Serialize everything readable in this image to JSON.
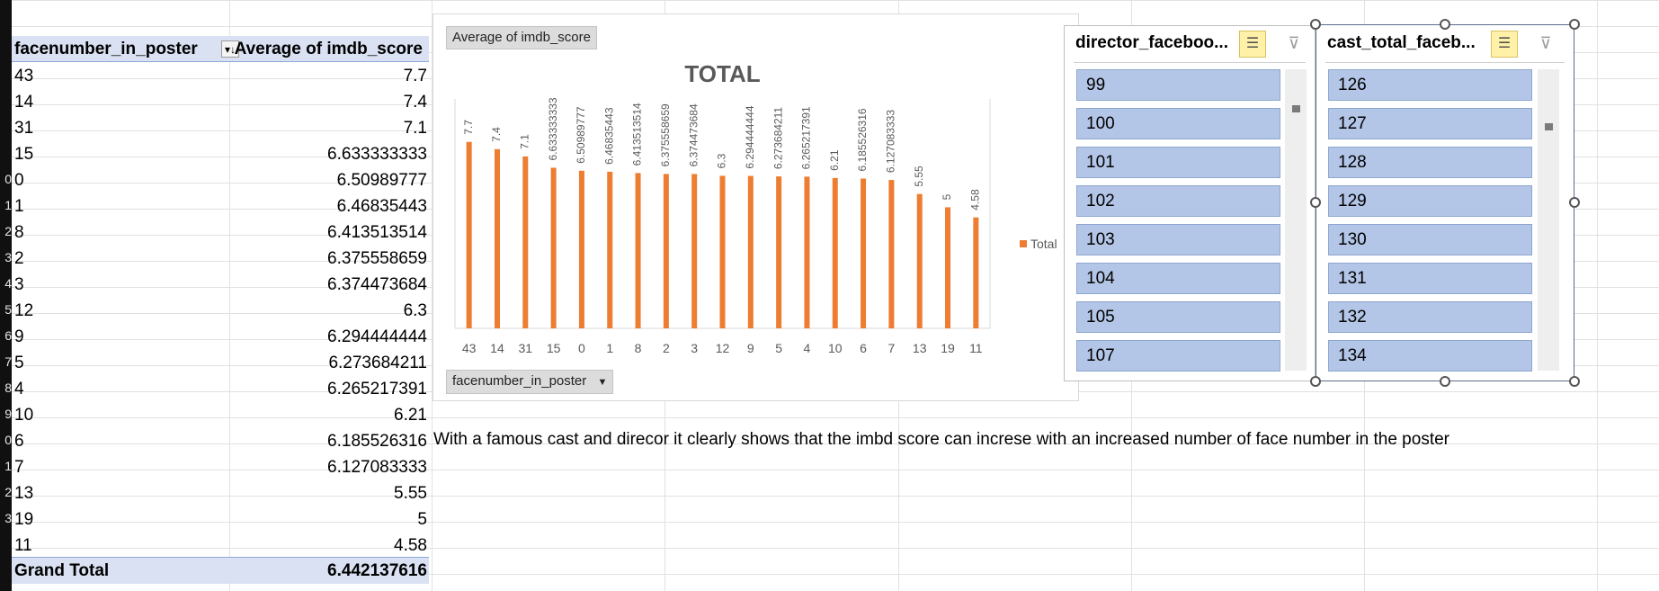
{
  "pivot": {
    "col1_header": "facenumber_in_poster",
    "col2_header": "Average of imdb_score",
    "sort_icon": "sort-descending-icon",
    "rows": [
      {
        "k": "43",
        "v": "7.7"
      },
      {
        "k": "14",
        "v": "7.4"
      },
      {
        "k": "31",
        "v": "7.1"
      },
      {
        "k": "15",
        "v": "6.633333333"
      },
      {
        "k": "0",
        "v": "6.50989777"
      },
      {
        "k": "1",
        "v": "6.46835443"
      },
      {
        "k": "8",
        "v": "6.413513514"
      },
      {
        "k": "2",
        "v": "6.375558659"
      },
      {
        "k": "3",
        "v": "6.374473684"
      },
      {
        "k": "12",
        "v": "6.3"
      },
      {
        "k": "9",
        "v": "6.294444444"
      },
      {
        "k": "5",
        "v": "6.273684211"
      },
      {
        "k": "4",
        "v": "6.265217391"
      },
      {
        "k": "10",
        "v": "6.21"
      },
      {
        "k": "6",
        "v": "6.185526316"
      },
      {
        "k": "7",
        "v": "6.127083333"
      },
      {
        "k": "13",
        "v": "5.55"
      },
      {
        "k": "19",
        "v": "5"
      },
      {
        "k": "11",
        "v": "4.58"
      }
    ],
    "grand_total_label": "Grand Total",
    "grand_total_value": "6.442137616"
  },
  "row_numbers": [
    "",
    "",
    "",
    "",
    "",
    "",
    "",
    "0",
    "1",
    "2",
    "3",
    "4",
    "5",
    "6",
    "7",
    "8",
    "9",
    "0",
    "1",
    "2",
    "3"
  ],
  "note": "With a famous cast and direcor it clearly shows that the imbd score can increse with an increased number of face number in the poster",
  "chart": {
    "value_field_button": "Average of imdb_score",
    "axis_field_button": "facenumber_in_poster",
    "dropdown_icon": "dropdown-arrow-icon",
    "legend_label": "Total",
    "bar_color": "#ed7d31"
  },
  "chart_data": {
    "type": "bar",
    "title": "TOTAL",
    "categories": [
      "43",
      "14",
      "31",
      "15",
      "0",
      "1",
      "8",
      "2",
      "3",
      "12",
      "9",
      "5",
      "4",
      "10",
      "6",
      "7",
      "13",
      "19",
      "11"
    ],
    "series": [
      {
        "name": "Total",
        "values": [
          7.7,
          7.4,
          7.1,
          6.633333333,
          6.50989777,
          6.46835443,
          6.413513514,
          6.375558659,
          6.374473684,
          6.3,
          6.294444444,
          6.273684211,
          6.265217391,
          6.21,
          6.185526316,
          6.127083333,
          5.55,
          5,
          4.58
        ]
      }
    ],
    "data_labels": [
      "7.7",
      "7.4",
      "7.1",
      "6.633333333",
      "6.50989777",
      "6.46835443",
      "6.413513514",
      "6.375558659",
      "6.374473684",
      "6.3",
      "6.294444444",
      "6.273684211",
      "6.265217391",
      "6.21",
      "6.185526316",
      "6.127083333",
      "5.55",
      "5",
      "4.58"
    ],
    "ylim": [
      0,
      9
    ],
    "legend_position": "right",
    "grid": false
  },
  "slicers": [
    {
      "title": "director_faceboo...",
      "items": [
        "99",
        "100",
        "101",
        "102",
        "103",
        "104",
        "105",
        "107"
      ]
    },
    {
      "title": "cast_total_faceb...",
      "items": [
        "126",
        "127",
        "128",
        "129",
        "130",
        "131",
        "132",
        "134"
      ]
    }
  ],
  "slicer_icons": {
    "multiselect": "multi-select-icon",
    "clear": "clear-filter-icon"
  }
}
